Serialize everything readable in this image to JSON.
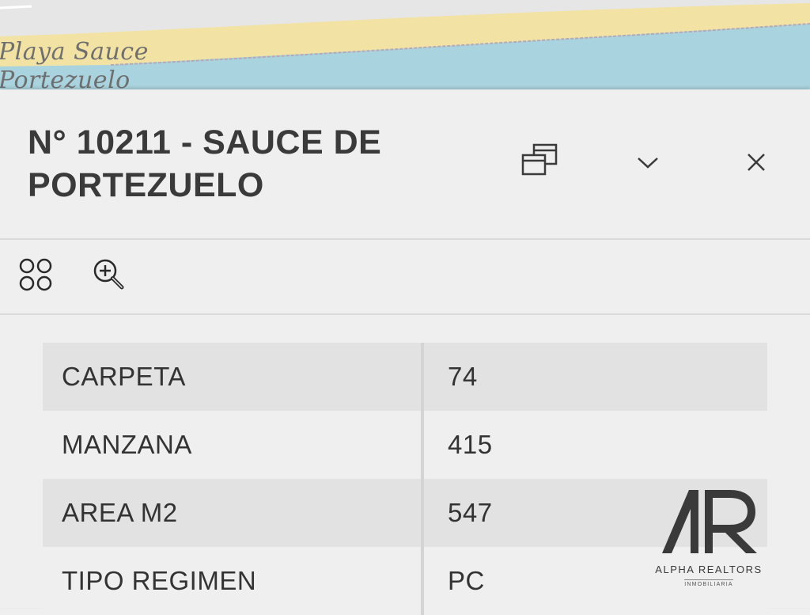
{
  "map": {
    "labels": [
      "Playa Sauce",
      "Portezuelo"
    ]
  },
  "panel": {
    "title": "N° 10211 - SAUCE DE PORTEZUELO",
    "buttons": {
      "dock": "dock-icon",
      "collapse": "chevron-down-icon",
      "close": "close-icon"
    },
    "toolbar": {
      "related": "related-features-icon",
      "zoom": "zoom-in-icon"
    }
  },
  "attributes": [
    {
      "key": "CARPETA",
      "value": "74"
    },
    {
      "key": "MANZANA",
      "value": "415"
    },
    {
      "key": "AREA M2",
      "value": "547"
    },
    {
      "key": "TIPO REGIMEN",
      "value": "PC"
    }
  ],
  "watermark": {
    "name": "ALPHA REALTORS",
    "subtitle": "INMOBILIARIA"
  },
  "colors": {
    "sea": "#a9d3de",
    "sand": "#f2e2a4",
    "land": "#e6e6e6",
    "text": "#333333"
  }
}
